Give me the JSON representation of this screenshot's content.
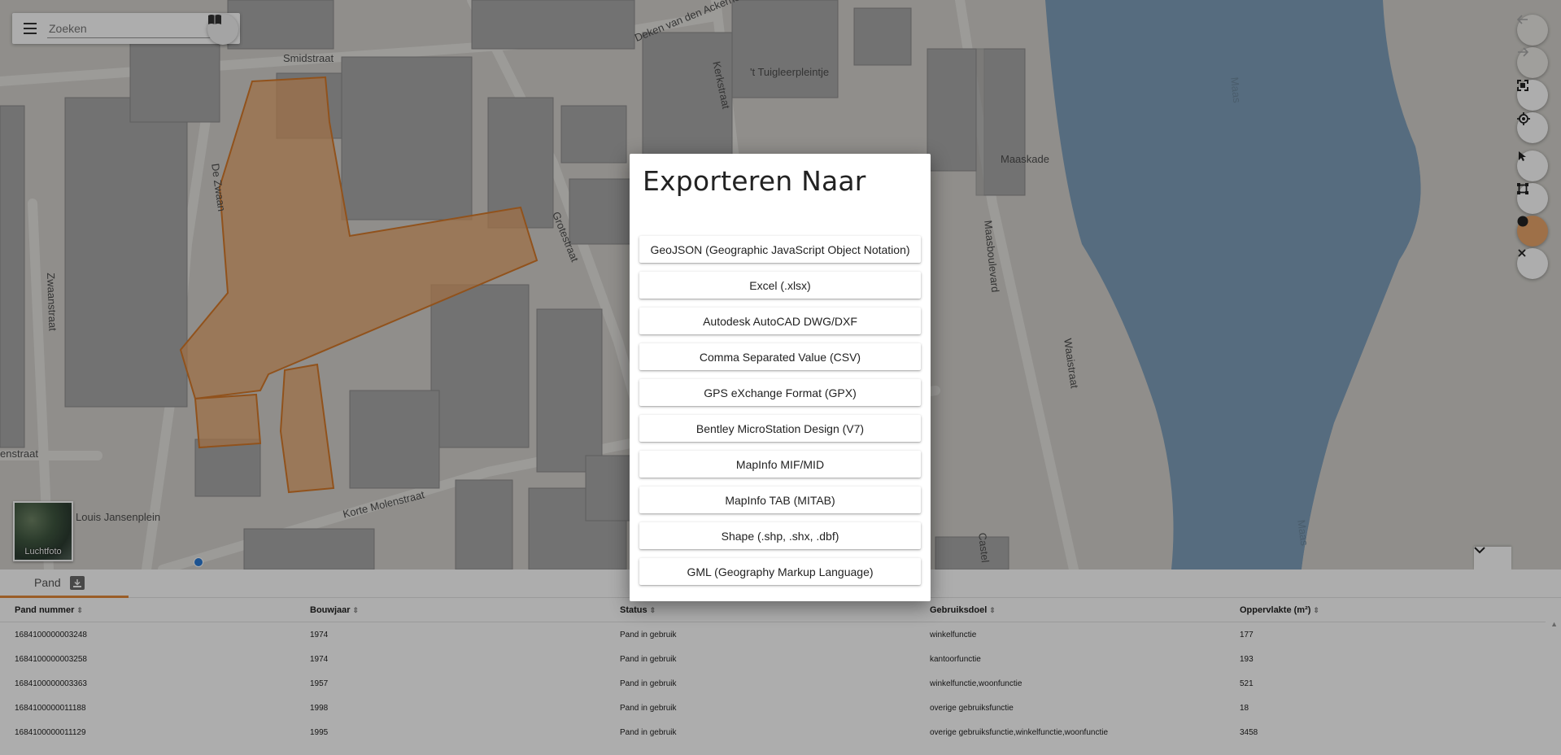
{
  "search": {
    "placeholder": "Zoeken",
    "menu_icon": "menu-icon",
    "book_icon": "book-icon"
  },
  "map": {
    "street_labels": [
      "Smidstraat",
      "Deken van den Ackerhof",
      "Kerkstraat",
      "'t Tuigleerpleintje",
      "De Zwaan",
      "Zwaanstraat",
      "Grotestraat",
      "Maasboulevard",
      "Maaskade",
      "Waaistraat",
      "Louis Jansenplein",
      "Korte Molenstraat",
      "enstraat",
      "Castel"
    ],
    "river_labels": [
      "Maas",
      "Maas"
    ],
    "aerial_label": "Luchtfoto",
    "colors": {
      "selection": "#e9a66a",
      "water": "#7f9fbb",
      "land": "#d4d2cd",
      "building": "#a8a8a8"
    }
  },
  "toolbar": {
    "icons": [
      "back-arrow-icon",
      "forward-arrow-icon",
      "fullscreen-icon",
      "locate-icon",
      "pointer-icon",
      "polygon-select-icon",
      "circle-select-icon",
      "close-icon"
    ]
  },
  "panel": {
    "tab_label": "Pand",
    "columns": [
      "Pand nummer",
      "Bouwjaar",
      "Status",
      "Gebruiksdoel",
      "Oppervlakte (m²)"
    ],
    "rows": [
      [
        "1684100000003248",
        "1974",
        "Pand in gebruik",
        "winkelfunctie",
        "177"
      ],
      [
        "1684100000003258",
        "1974",
        "Pand in gebruik",
        "kantoorfunctie",
        "193"
      ],
      [
        "1684100000003363",
        "1957",
        "Pand in gebruik",
        "winkelfunctie,woonfunctie",
        "521"
      ],
      [
        "1684100000011188",
        "1998",
        "Pand in gebruik",
        "overige gebruiksfunctie",
        "18"
      ],
      [
        "1684100000011129",
        "1995",
        "Pand in gebruik",
        "overige gebruiksfunctie,winkelfunctie,woonfunctie",
        "3458"
      ]
    ]
  },
  "dialog": {
    "title": "Exporteren Naar",
    "options": [
      "GeoJSON (Geographic JavaScript Object Notation)",
      "Excel (.xlsx)",
      "Autodesk AutoCAD DWG/DXF",
      "Comma Separated Value (CSV)",
      "GPS eXchange Format (GPX)",
      "Bentley MicroStation Design (V7)",
      "MapInfo MIF/MID",
      "MapInfo TAB (MITAB)",
      "Shape (.shp, .shx, .dbf)",
      "GML (Geography Markup Language)"
    ]
  }
}
